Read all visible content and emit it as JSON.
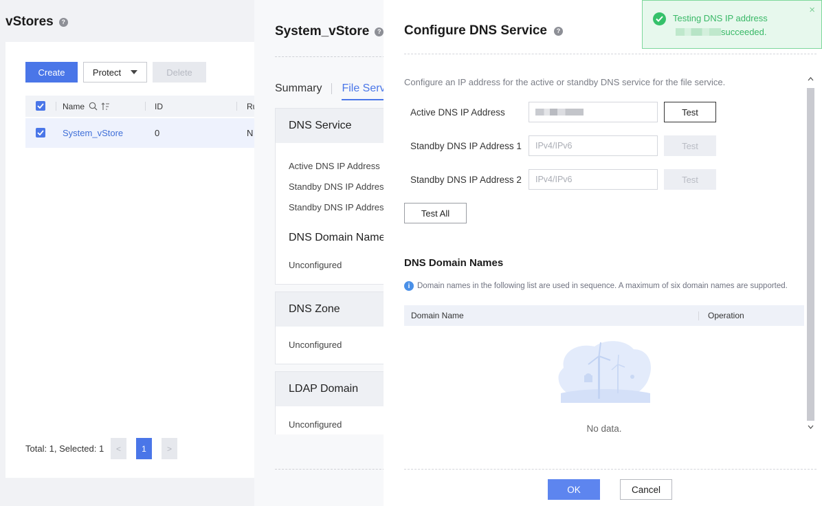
{
  "vstores": {
    "title": "vStores",
    "buttons": {
      "create": "Create",
      "protect": "Protect",
      "delete": "Delete"
    },
    "columns": [
      "Name",
      "ID",
      "Ru"
    ],
    "rows": [
      {
        "name": "System_vStore",
        "id": "0",
        "extra": "N"
      }
    ],
    "footer": {
      "total": "Total: 1, Selected: 1",
      "page": "1",
      "prev": "<",
      "next": ">"
    }
  },
  "system_panel": {
    "title": "System_vStore",
    "tabs": [
      "Summary",
      "File Servi"
    ],
    "cards": [
      {
        "title": "DNS Service",
        "lines": [
          "Active DNS IP Address",
          "Standby DNS IP Addres",
          "Standby DNS IP Addres"
        ],
        "subheading": "DNS Domain Names",
        "value": "Unconfigured"
      },
      {
        "title": "DNS Zone",
        "value": "Unconfigured"
      },
      {
        "title": "LDAP Domain",
        "value": "Unconfigured"
      }
    ]
  },
  "dialog": {
    "title": "Configure DNS Service",
    "description": "Configure an IP address for the active or standby DNS service for the file service.",
    "fields": [
      {
        "label": "Active DNS IP Address",
        "value": "",
        "placeholder": "IPv4/IPv6",
        "test": "Test",
        "test_enabled": true
      },
      {
        "label": "Standby DNS IP Address 1",
        "value": "",
        "placeholder": "IPv4/IPv6",
        "test": "Test",
        "test_enabled": false
      },
      {
        "label": "Standby DNS IP Address 2",
        "value": "",
        "placeholder": "IPv4/IPv6",
        "test": "Test",
        "test_enabled": false
      }
    ],
    "test_all": "Test All",
    "domain_section": {
      "title": "DNS Domain Names",
      "info": "Domain names in the following list are used in sequence. A maximum of six domain names are supported.",
      "columns": [
        "Domain Name",
        "Operation"
      ],
      "empty": "No data."
    },
    "ok": "OK",
    "cancel": "Cancel"
  },
  "toast": {
    "line1": "Testing DNS IP address",
    "line2": "succeeded.",
    "close": "×"
  },
  "colors": {
    "primary": "#4a76e8",
    "success": "#35c16a",
    "overlay": "#9a9ba4"
  }
}
